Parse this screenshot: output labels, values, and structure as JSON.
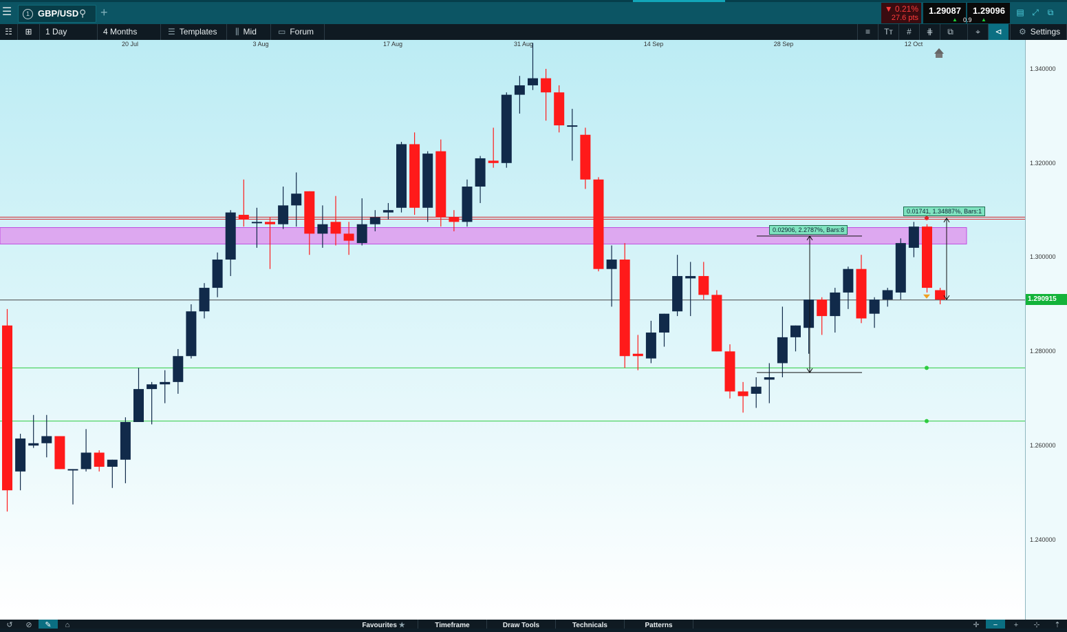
{
  "top_bar": {
    "menu_icon": "hamburger-icon",
    "symbol": "GBP/USD",
    "symbol_index": "1",
    "search_icon": "magnifier-icon",
    "add_tab": "+",
    "change_pct": "▼ 0.21%",
    "change_pts": "27.6 pts",
    "bid": "1.29087",
    "ask": "1.29096",
    "spread": "0.9",
    "window_icons": [
      "minimize-to-panel-icon",
      "expand-icon",
      "popout-icon",
      "close-icon"
    ]
  },
  "toolbar": {
    "interval": "1 Day",
    "range": "4 Months",
    "templates": "Templates",
    "price_type": "Mid",
    "forum": "Forum",
    "settings": "Settings",
    "right_icons": [
      "text-icon",
      "font-size-icon",
      "grid-icon",
      "crosshair-grid-icon",
      "layers-icon",
      "target-icon",
      "tag-icon"
    ]
  },
  "chart_data": {
    "type": "candlestick",
    "symbol": "GBP/USD",
    "x_dates": [
      "20 Jul",
      "3 Aug",
      "17 Aug",
      "31 Aug",
      "14 Sep",
      "28 Sep",
      "12 Oct"
    ],
    "ylim": [
      1.226,
      1.349
    ],
    "y_ticks": [
      "1.340000",
      "1.320000",
      "1.300000",
      "1.280000",
      "1.260000",
      "1.240000"
    ],
    "current_price": "1.290915",
    "colors": {
      "up": "#112a4a",
      "down": "#ff1a1a",
      "zone": "#dda8f0",
      "support": "#2ecc40",
      "resistance": "#d2232a",
      "price_tag": "#13b33a"
    },
    "candles": [
      [
        1.2855,
        1.289,
        1.246,
        1.2505
      ],
      [
        1.2545,
        1.2625,
        1.2505,
        1.2615
      ],
      [
        1.26,
        1.2665,
        1.2595,
        1.2605
      ],
      [
        1.2605,
        1.2665,
        1.2575,
        1.262
      ],
      [
        1.262,
        1.262,
        1.255,
        1.255
      ],
      [
        1.255,
        1.255,
        1.2475,
        1.255
      ],
      [
        1.255,
        1.2635,
        1.2545,
        1.2585
      ],
      [
        1.2585,
        1.259,
        1.2545,
        1.2555
      ],
      [
        1.2555,
        1.257,
        1.251,
        1.257
      ],
      [
        1.257,
        1.266,
        1.252,
        1.265
      ],
      [
        1.265,
        1.2765,
        1.265,
        1.272
      ],
      [
        1.272,
        1.2735,
        1.2645,
        1.273
      ],
      [
        1.273,
        1.276,
        1.269,
        1.2735
      ],
      [
        1.2735,
        1.2805,
        1.271,
        1.279
      ],
      [
        1.279,
        1.29,
        1.2785,
        1.2885
      ],
      [
        1.2885,
        1.2945,
        1.287,
        1.2935
      ],
      [
        1.2935,
        1.301,
        1.2915,
        1.2995
      ],
      [
        1.2995,
        1.31,
        1.296,
        1.3095
      ],
      [
        1.309,
        1.3165,
        1.3065,
        1.308
      ],
      [
        1.3075,
        1.3105,
        1.302,
        1.3075
      ],
      [
        1.3075,
        1.3085,
        1.2975,
        1.307
      ],
      [
        1.307,
        1.315,
        1.306,
        1.311
      ],
      [
        1.311,
        1.318,
        1.3065,
        1.3135
      ],
      [
        1.314,
        1.314,
        1.3005,
        1.305
      ],
      [
        1.305,
        1.311,
        1.302,
        1.307
      ],
      [
        1.3075,
        1.313,
        1.3025,
        1.305
      ],
      [
        1.305,
        1.3075,
        1.3005,
        1.3035
      ],
      [
        1.303,
        1.3125,
        1.3025,
        1.307
      ],
      [
        1.307,
        1.31,
        1.3055,
        1.3085
      ],
      [
        1.3095,
        1.3115,
        1.308,
        1.31
      ],
      [
        1.3105,
        1.3245,
        1.3095,
        1.324
      ],
      [
        1.324,
        1.3265,
        1.309,
        1.3105
      ],
      [
        1.3105,
        1.3225,
        1.3075,
        1.322
      ],
      [
        1.3225,
        1.325,
        1.3065,
        1.3085
      ],
      [
        1.3085,
        1.31,
        1.3055,
        1.3075
      ],
      [
        1.3075,
        1.3165,
        1.3065,
        1.315
      ],
      [
        1.315,
        1.3215,
        1.3115,
        1.321
      ],
      [
        1.3205,
        1.3275,
        1.319,
        1.32
      ],
      [
        1.32,
        1.335,
        1.319,
        1.3345
      ],
      [
        1.3345,
        1.3385,
        1.3305,
        1.3365
      ],
      [
        1.3365,
        1.3455,
        1.3355,
        1.338
      ],
      [
        1.338,
        1.34,
        1.329,
        1.335
      ],
      [
        1.335,
        1.3365,
        1.3265,
        1.328
      ],
      [
        1.328,
        1.3315,
        1.3205,
        1.328
      ],
      [
        1.326,
        1.3275,
        1.3145,
        1.3165
      ],
      [
        1.3165,
        1.317,
        1.297,
        1.2975
      ],
      [
        1.2975,
        1.3025,
        1.2895,
        1.2995
      ],
      [
        1.2995,
        1.303,
        1.2765,
        1.279
      ],
      [
        1.2795,
        1.2835,
        1.276,
        1.279
      ],
      [
        1.2785,
        1.2865,
        1.2775,
        1.284
      ],
      [
        1.284,
        1.288,
        1.281,
        1.288
      ],
      [
        1.2885,
        1.3005,
        1.2875,
        1.296
      ],
      [
        1.2955,
        1.299,
        1.2875,
        1.296
      ],
      [
        1.296,
        1.299,
        1.291,
        1.292
      ],
      [
        1.292,
        1.293,
        1.28,
        1.28
      ],
      [
        1.28,
        1.2815,
        1.27,
        1.2715
      ],
      [
        1.2715,
        1.2735,
        1.267,
        1.2705
      ],
      [
        1.271,
        1.2745,
        1.268,
        1.2725
      ],
      [
        1.274,
        1.2775,
        1.269,
        1.2745
      ],
      [
        1.2775,
        1.2895,
        1.2745,
        1.283
      ],
      [
        1.283,
        1.2855,
        1.28,
        1.2855
      ],
      [
        1.285,
        1.2905,
        1.2795,
        1.291
      ],
      [
        1.291,
        1.2915,
        1.2835,
        1.2875
      ],
      [
        1.2875,
        1.2935,
        1.284,
        1.2925
      ],
      [
        1.2925,
        1.298,
        1.289,
        1.2975
      ],
      [
        1.2975,
        1.3005,
        1.286,
        1.287
      ],
      [
        1.288,
        1.2915,
        1.285,
        1.291
      ],
      [
        1.291,
        1.2935,
        1.2895,
        1.293
      ],
      [
        1.2925,
        1.304,
        1.291,
        1.303
      ],
      [
        1.302,
        1.3075,
        1.3,
        1.3065
      ],
      [
        1.3065,
        1.307,
        1.2925,
        1.2935
      ],
      [
        1.293,
        1.2935,
        1.29,
        1.291
      ]
    ],
    "zone": {
      "from": 1.3028,
      "to": 1.3063
    },
    "resistance": 1.3083,
    "current_line": 1.290915,
    "support_lines": [
      1.2765,
      1.2652
    ],
    "measure_1": {
      "label": "0.02906, 2.2787%, Bars:8",
      "from": 1.3045,
      "to": 1.2755
    },
    "measure_2": {
      "label": "0.01741, 1.34887%, Bars:1",
      "from": 1.3083,
      "to": 1.291
    }
  },
  "bottom_bar": {
    "left_icons": [
      "history-icon",
      "hide-icon",
      "pencil-icon",
      "magnet-icon"
    ],
    "tabs": [
      "Favourites",
      "Timeframe",
      "Draw Tools",
      "Technicals",
      "Patterns"
    ],
    "favourites_star": "star-icon",
    "right_icons": [
      "crosshair-icon",
      "zoom-out-icon",
      "zoom-in-icon",
      "pan-icon",
      "upload-icon"
    ]
  }
}
